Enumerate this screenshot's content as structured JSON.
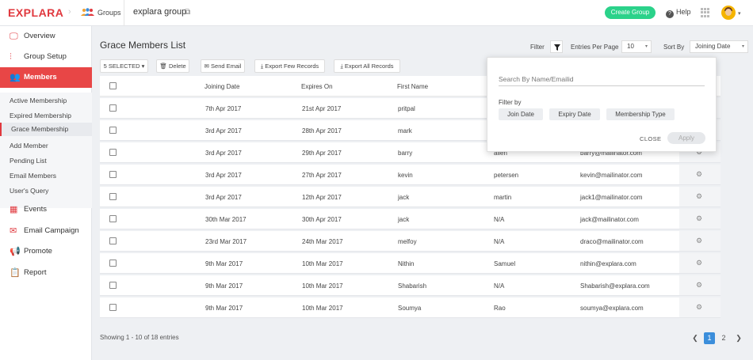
{
  "header": {
    "logo": "EXPLARA",
    "groups_label": "Groups",
    "group_name": "explara group",
    "create_group": "Create Group",
    "help": "Help"
  },
  "sidebar": {
    "nav": [
      {
        "label": "Overview",
        "icon": "monitor-icon"
      },
      {
        "label": "Group Setup",
        "icon": "sliders-icon"
      },
      {
        "label": "Members",
        "icon": "users-icon",
        "active": true
      }
    ],
    "sub": [
      "Active Membership",
      "Expired Membership",
      "Grace Membership",
      "Add Member",
      "Pending List",
      "Email Members",
      "User's Query"
    ],
    "nav2": [
      {
        "label": "Events",
        "icon": "calendar-icon"
      },
      {
        "label": "Email Campaign",
        "icon": "mail-icon"
      },
      {
        "label": "Promote",
        "icon": "megaphone-icon"
      },
      {
        "label": "Report",
        "icon": "clipboard-icon"
      }
    ]
  },
  "main": {
    "title": "Grace Members List",
    "filter_label": "Filter",
    "entries_label": "Entries Per Page",
    "entries_value": "10",
    "sort_label": "Sort By",
    "sort_value": "Joining Date",
    "toolbar": {
      "selected": "5 SELECTED",
      "delete": "Delete",
      "send_email": "Send Email",
      "export_few": "Export Few Records",
      "export_all": "Export All Records"
    },
    "columns": [
      "Joining Date",
      "Expires On",
      "First Name"
    ],
    "rows": [
      {
        "join": "7th Apr 2017",
        "expires": "21st Apr 2017",
        "first": "pritpal",
        "last": "",
        "email": ""
      },
      {
        "join": "3rd Apr 2017",
        "expires": "28th Apr 2017",
        "first": "mark",
        "last": "",
        "email": ""
      },
      {
        "join": "3rd Apr 2017",
        "expires": "29th Apr 2017",
        "first": "barry",
        "last": "allen",
        "email": "barry@mailinator.com"
      },
      {
        "join": "3rd Apr 2017",
        "expires": "27th Apr 2017",
        "first": "kevin",
        "last": "petersen",
        "email": "kevin@mailinator.com"
      },
      {
        "join": "3rd Apr 2017",
        "expires": "12th Apr 2017",
        "first": "jack",
        "last": "martin",
        "email": "jack1@mailinator.com"
      },
      {
        "join": "30th Mar 2017",
        "expires": "30th Apr 2017",
        "first": "jack",
        "last": "N/A",
        "email": "jack@mailinator.com"
      },
      {
        "join": "23rd Mar 2017",
        "expires": "24th Mar 2017",
        "first": "melfoy",
        "last": "N/A",
        "email": "draco@mailinator.com"
      },
      {
        "join": "9th Mar 2017",
        "expires": "10th Mar 2017",
        "first": "Nithin",
        "last": "Samuel",
        "email": "nithin@explara.com"
      },
      {
        "join": "9th Mar 2017",
        "expires": "10th Mar 2017",
        "first": "Shabarish",
        "last": "N/A",
        "email": "Shabarish@explara.com"
      },
      {
        "join": "9th Mar 2017",
        "expires": "10th Mar 2017",
        "first": "Soumya",
        "last": "Rao",
        "email": "soumya@explara.com"
      }
    ],
    "showing": "Showing 1 - 10 of 18 entries",
    "pages": [
      "1",
      "2"
    ]
  },
  "filter_panel": {
    "search_placeholder": "Search By Name/Emailid",
    "filter_by": "Filter by",
    "chips": [
      "Join Date",
      "Expiry Date",
      "Membership Type"
    ],
    "close": "CLOSE",
    "apply": "Apply"
  },
  "colors": {
    "brand": "#e0383e",
    "create": "#2bd28a",
    "page_active": "#3b8edb"
  }
}
